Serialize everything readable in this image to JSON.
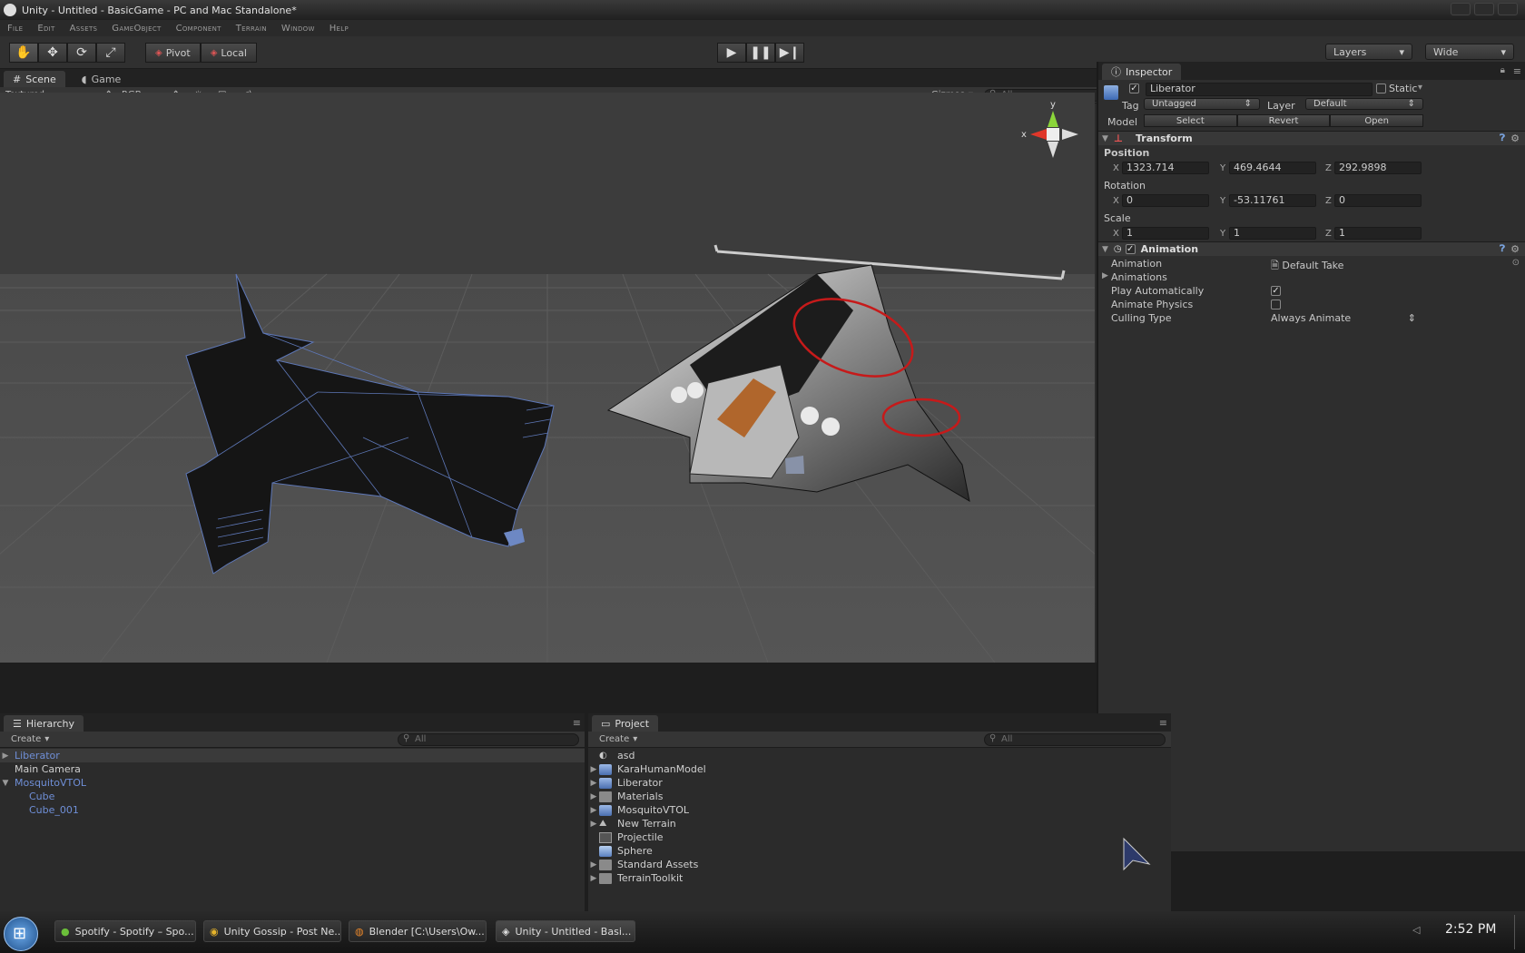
{
  "window": {
    "title": "Unity - Untitled - BasicGame - PC and Mac Standalone*"
  },
  "menu": [
    "File",
    "Edit",
    "Assets",
    "GameObject",
    "Component",
    "Terrain",
    "Window",
    "Help"
  ],
  "toolbar": {
    "pivot_label": "Pivot",
    "local_label": "Local",
    "layers_label": "Layers",
    "layout_label": "Wide"
  },
  "scene": {
    "tabs": [
      "Scene",
      "Game"
    ],
    "render_mode": "Textured",
    "channel_mode": "RGB",
    "gizmos_label": "Gizmos",
    "search_placeholder": "All",
    "axis_y": "y",
    "axis_x": "x"
  },
  "hierarchy": {
    "tab": "Hierarchy",
    "create_label": "Create",
    "search_placeholder": "All",
    "items": [
      {
        "label": "Liberator"
      },
      {
        "label": "Main Camera"
      },
      {
        "label": "MosquitoVTOL"
      },
      {
        "label": "Cube"
      },
      {
        "label": "Cube_001"
      }
    ]
  },
  "project": {
    "tab": "Project",
    "create_label": "Create",
    "search_placeholder": "All",
    "items": [
      {
        "label": "asd"
      },
      {
        "label": "KaraHumanModel"
      },
      {
        "label": "Liberator"
      },
      {
        "label": "Materials"
      },
      {
        "label": "MosquitoVTOL"
      },
      {
        "label": "New Terrain"
      },
      {
        "label": "Projectile"
      },
      {
        "label": "Sphere"
      },
      {
        "label": "Standard Assets"
      },
      {
        "label": "TerrainToolkit"
      }
    ]
  },
  "inspector": {
    "tab": "Inspector",
    "object_name": "Liberator",
    "static_label": "Static",
    "tag_label": "Tag",
    "tag_value": "Untagged",
    "layer_label": "Layer",
    "layer_value": "Default",
    "model_label": "Model",
    "select_label": "Select",
    "revert_label": "Revert",
    "open_label": "Open",
    "transform": {
      "title": "Transform",
      "position_label": "Position",
      "rotation_label": "Rotation",
      "scale_label": "Scale",
      "axis_x": "X",
      "axis_y": "Y",
      "axis_z": "Z",
      "position": {
        "x": "1323.714",
        "y": "469.4644",
        "z": "292.9898"
      },
      "rotation": {
        "x": "0",
        "y": "-53.11761",
        "z": "0"
      },
      "scale": {
        "x": "1",
        "y": "1",
        "z": "1"
      }
    },
    "animation": {
      "title": "Animation",
      "animation_label": "Animation",
      "animation_value": "Default Take",
      "animations_label": "Animations",
      "play_auto_label": "Play Automatically",
      "animate_physics_label": "Animate Physics",
      "culling_label": "Culling Type",
      "culling_value": "Always Animate"
    }
  },
  "taskbar": {
    "items": [
      {
        "label": "Spotify - Spotify – Spo..."
      },
      {
        "label": "Unity Gossip - Post Ne..."
      },
      {
        "label": "Blender [C:\\Users\\Ow..."
      },
      {
        "label": "Unity - Untitled - Basi..."
      }
    ],
    "clock": "2:52 PM"
  }
}
